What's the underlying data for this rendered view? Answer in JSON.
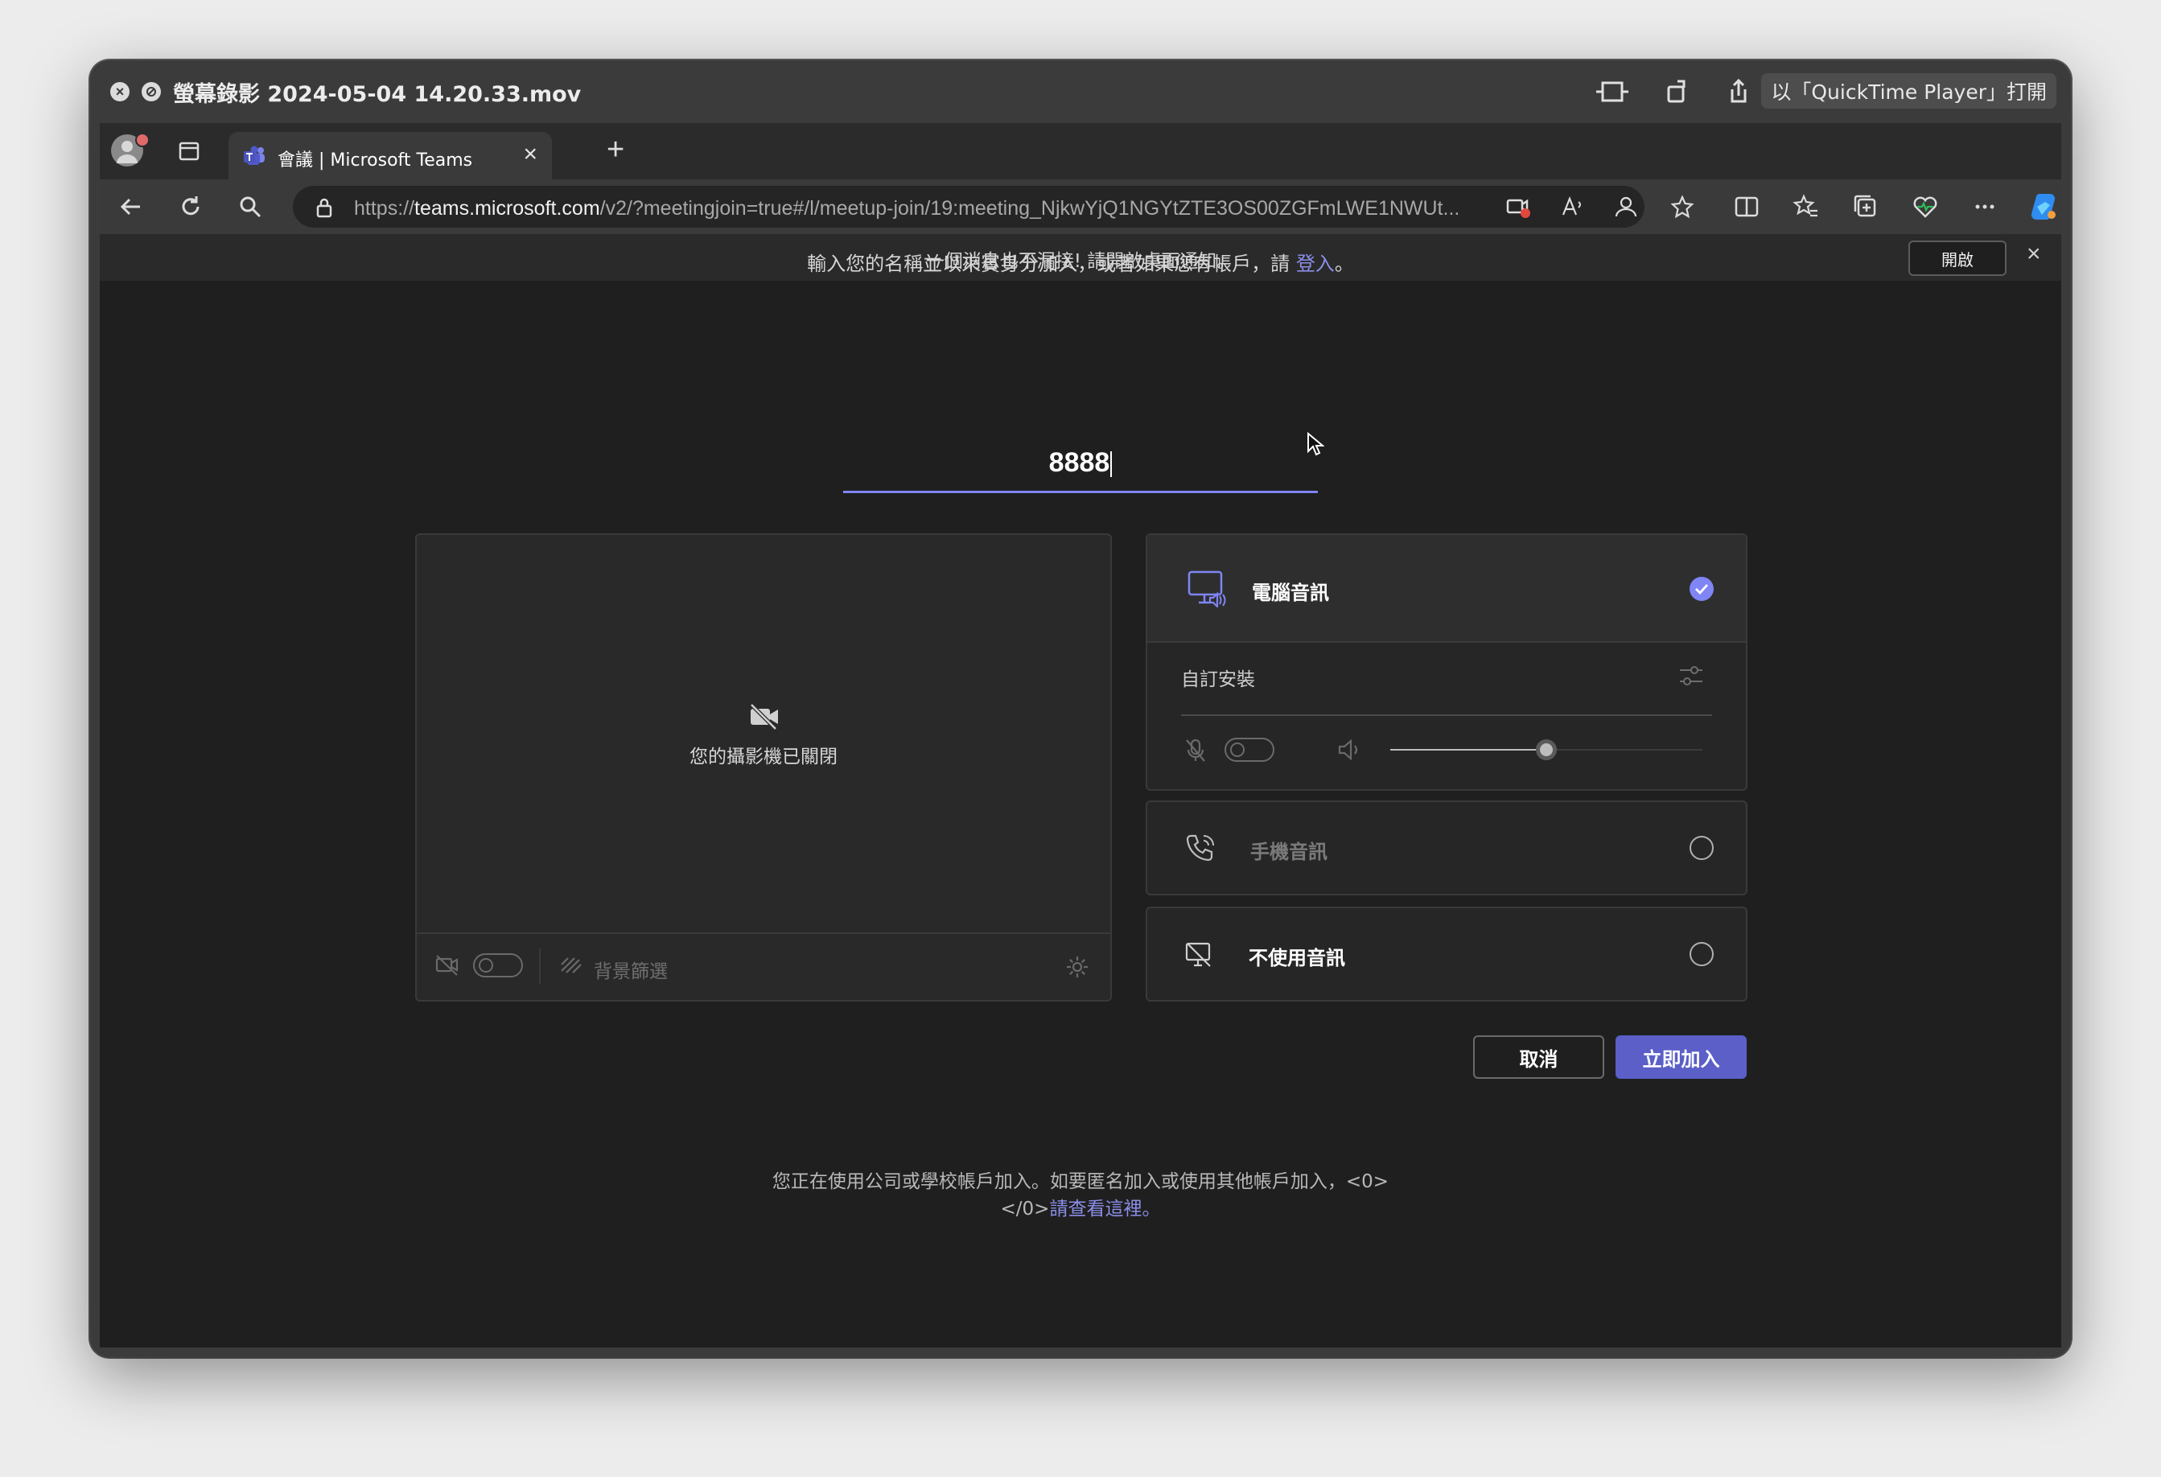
{
  "qt": {
    "title": "螢幕錄影 2024-05-04 14.20.33.mov",
    "open_with": "以「QuickTime Player」打開"
  },
  "browser": {
    "tab_title": "會議 | Microsoft Teams",
    "url_prefix": "https://",
    "url_host": "teams.microsoft.com",
    "url_path": "/v2/?meetingjoin=true#/l/meetup-join/19:meeting_NjkwYjQ1NGYtZTE3OS00ZGFmLWE1NWUt..."
  },
  "notification": {
    "text": "一個消息也不漏接! 請開啟桌面通知。",
    "button": "開啟"
  },
  "join": {
    "prompt_before": "輸入您的名稱並以來賓身分加入，或者如果您有帳戶，請 ",
    "signin_link": "登入",
    "prompt_after": "。",
    "name_value": "8888"
  },
  "video": {
    "camera_off": "您的攝影機已關閉",
    "background_filter": "背景篩選",
    "camera_enabled": false
  },
  "audio": {
    "computer_audio": "電腦音訊",
    "custom_setup": "自訂安裝",
    "phone_audio": "手機音訊",
    "no_audio": "不使用音訊",
    "selected": "computer_audio",
    "mic_enabled": false,
    "volume": 0.5
  },
  "actions": {
    "cancel": "取消",
    "join_now": "立即加入"
  },
  "footer": {
    "line1": "您正在使用公司或學校帳戶加入。如要匿名加入或使用其他帳戶加入，<0>",
    "line2_prefix": "</0>",
    "line2_link": "請查看這裡。"
  },
  "colors": {
    "accent": "#7f85f5",
    "join_button": "#5b5fc7",
    "background": "#1f1f1f"
  }
}
